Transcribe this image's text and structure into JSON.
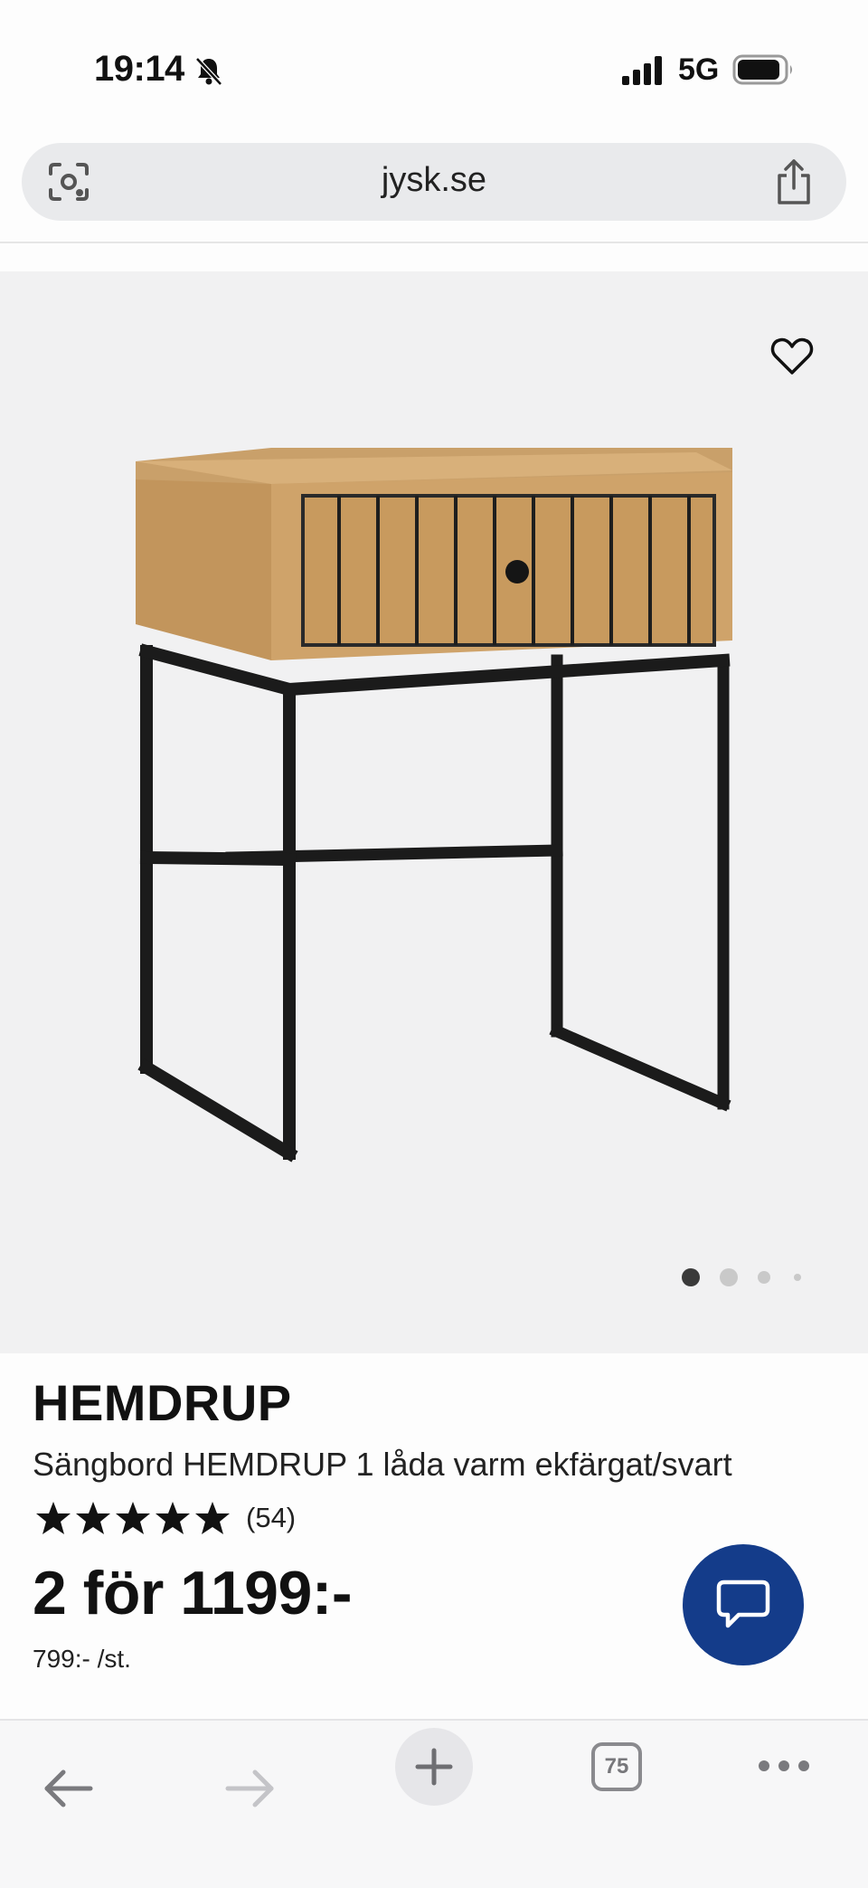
{
  "status_bar": {
    "time": "19:14",
    "network": "5G",
    "icons": [
      "bell-slash-icon",
      "signal-bars-icon",
      "battery-icon"
    ]
  },
  "address_bar": {
    "url": "jysk.se",
    "icons": [
      "visual-search-icon",
      "share-icon"
    ]
  },
  "gallery": {
    "image_count": 4,
    "active_index": 1,
    "icons": [
      "heart-icon"
    ]
  },
  "product": {
    "brand": "HEMDRUP",
    "title": "Sängbord HEMDRUP 1 låda varm ekfärgat/svart",
    "rating_stars": 5,
    "review_count": "(54)",
    "price": "2 för 1199:-",
    "unit_price": "799:- /st."
  },
  "chat": {
    "icon": "chat-bubble-icon",
    "color": "#143c8a"
  },
  "toolbar": {
    "tabs_count": "75",
    "icons": [
      "back-arrow-icon",
      "forward-arrow-icon",
      "plus-icon",
      "tabs-icon",
      "more-icon"
    ]
  }
}
